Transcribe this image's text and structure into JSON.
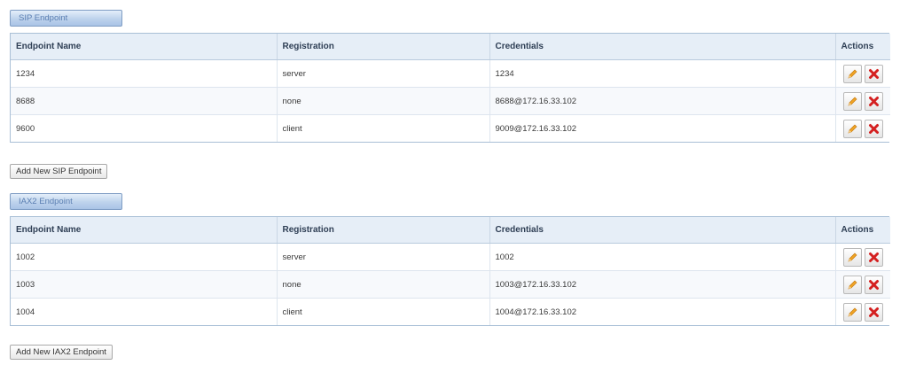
{
  "sip": {
    "title": "SIP Endpoint",
    "headers": [
      "Endpoint Name",
      "Registration",
      "Credentials",
      "Actions"
    ],
    "rows": [
      {
        "name": "1234",
        "registration": "server",
        "credentials": "1234"
      },
      {
        "name": "8688",
        "registration": "none",
        "credentials": "8688@172.16.33.102"
      },
      {
        "name": "9600",
        "registration": "client",
        "credentials": "9009@172.16.33.102"
      }
    ],
    "add_label": "Add New SIP Endpoint"
  },
  "iax": {
    "title": "IAX2 Endpoint",
    "headers": [
      "Endpoint Name",
      "Registration",
      "Credentials",
      "Actions"
    ],
    "rows": [
      {
        "name": "1002",
        "registration": "server",
        "credentials": "1002"
      },
      {
        "name": "1003",
        "registration": "none",
        "credentials": "1003@172.16.33.102"
      },
      {
        "name": "1004",
        "registration": "client",
        "credentials": "1004@172.16.33.102"
      }
    ],
    "add_label": "Add New IAX2 Endpoint"
  },
  "icons": {
    "edit": "pencil-icon",
    "delete": "delete-x-icon"
  },
  "colors": {
    "pencil": "#f0a424",
    "delete": "#d42020",
    "header_bg": "#e6eef7",
    "tab_text": "#5b7fb2"
  }
}
